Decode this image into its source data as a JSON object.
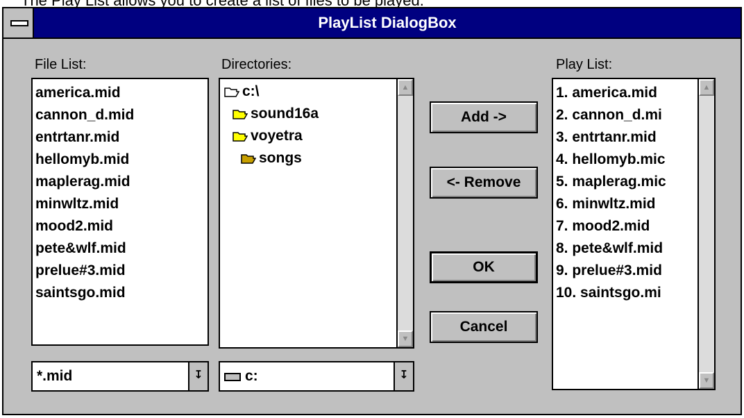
{
  "caption": "The Play List allows you to create a list of files to be played.",
  "dialog": {
    "title": "PlayList DialogBox",
    "file_list": {
      "label": "File List:",
      "items": [
        "america.mid",
        "cannon_d.mid",
        "entrtanr.mid",
        "hellomyb.mid",
        "maplerag.mid",
        "minwltz.mid",
        "mood2.mid",
        "pete&wlf.mid",
        "prelue#3.mid",
        "saintsgo.mid"
      ]
    },
    "directories": {
      "label": "Directories:",
      "items": [
        "c:\\",
        "sound16a",
        "voyetra",
        "songs"
      ]
    },
    "play_list": {
      "label": "Play List:",
      "items": [
        "1. america.mid",
        "2. cannon_d.mi",
        "3. entrtanr.mid",
        "4. hellomyb.mic",
        "5. maplerag.mic",
        "6. minwltz.mid",
        "7. mood2.mid",
        "8. pete&wlf.mid",
        "9. prelue#3.mid",
        "10. saintsgo.mi"
      ]
    },
    "filter_value": "*.mid",
    "drive_value": "c:",
    "buttons": {
      "add": "Add ->",
      "remove": "<- Remove",
      "ok": "OK",
      "cancel": "Cancel"
    }
  }
}
